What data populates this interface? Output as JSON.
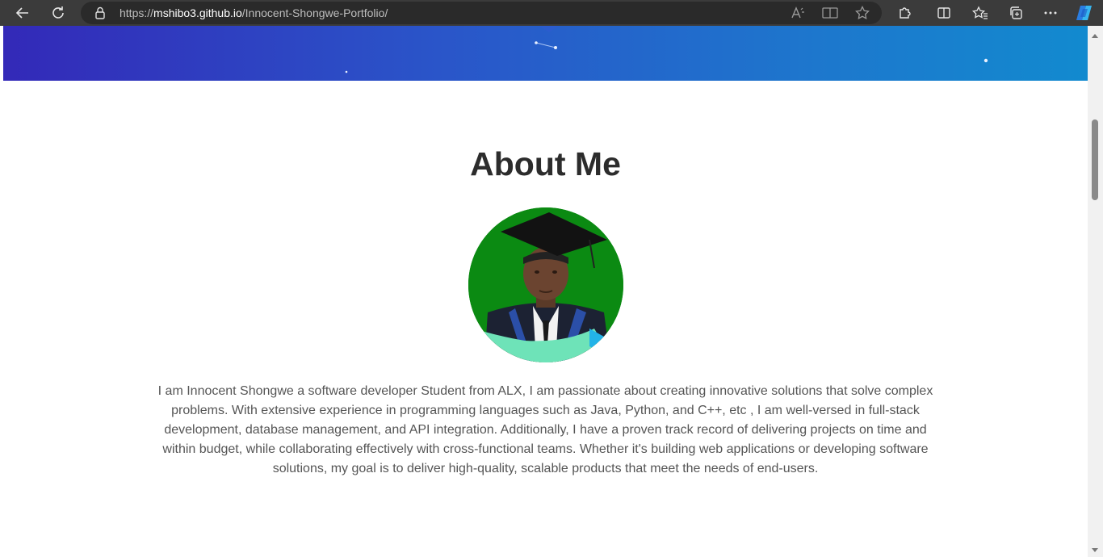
{
  "browser": {
    "url_host": "mshibo3.github.io",
    "url_prefix": "https://",
    "url_path": "/Innocent-Shongwe-Portfolio/"
  },
  "about": {
    "title": "About Me",
    "text": "I am Innocent Shongwe a software developer Student from ALX, I am passionate about creating innovative solutions that solve complex problems. With extensive experience in programming languages such as Java, Python, and C++, etc , I am well-versed in full-stack development, database management, and API integration. Additionally, I have a proven track record of delivering projects on time and within budget, while collaborating effectively with cross-functional teams. Whether it's building web applications or developing software solutions, my goal is to deliver high-quality, scalable products that meet the needs of end-users."
  },
  "icons": {
    "back": "back-arrow-icon",
    "refresh": "refresh-icon",
    "lock": "lock-icon",
    "read_aloud": "read-aloud-icon",
    "immersive_reader": "immersive-reader-icon",
    "favorite": "star-icon",
    "extensions": "puzzle-icon",
    "split_screen": "split-screen-icon",
    "favorites": "favorites-icon",
    "collections": "collections-icon",
    "more": "more-icon",
    "copilot": "copilot-icon"
  },
  "colors": {
    "hero_start": "#3329b8",
    "hero_end": "#128acf",
    "avatar_bg": "#0b8a12",
    "title": "#2c2c2c",
    "body_text": "#555555"
  }
}
